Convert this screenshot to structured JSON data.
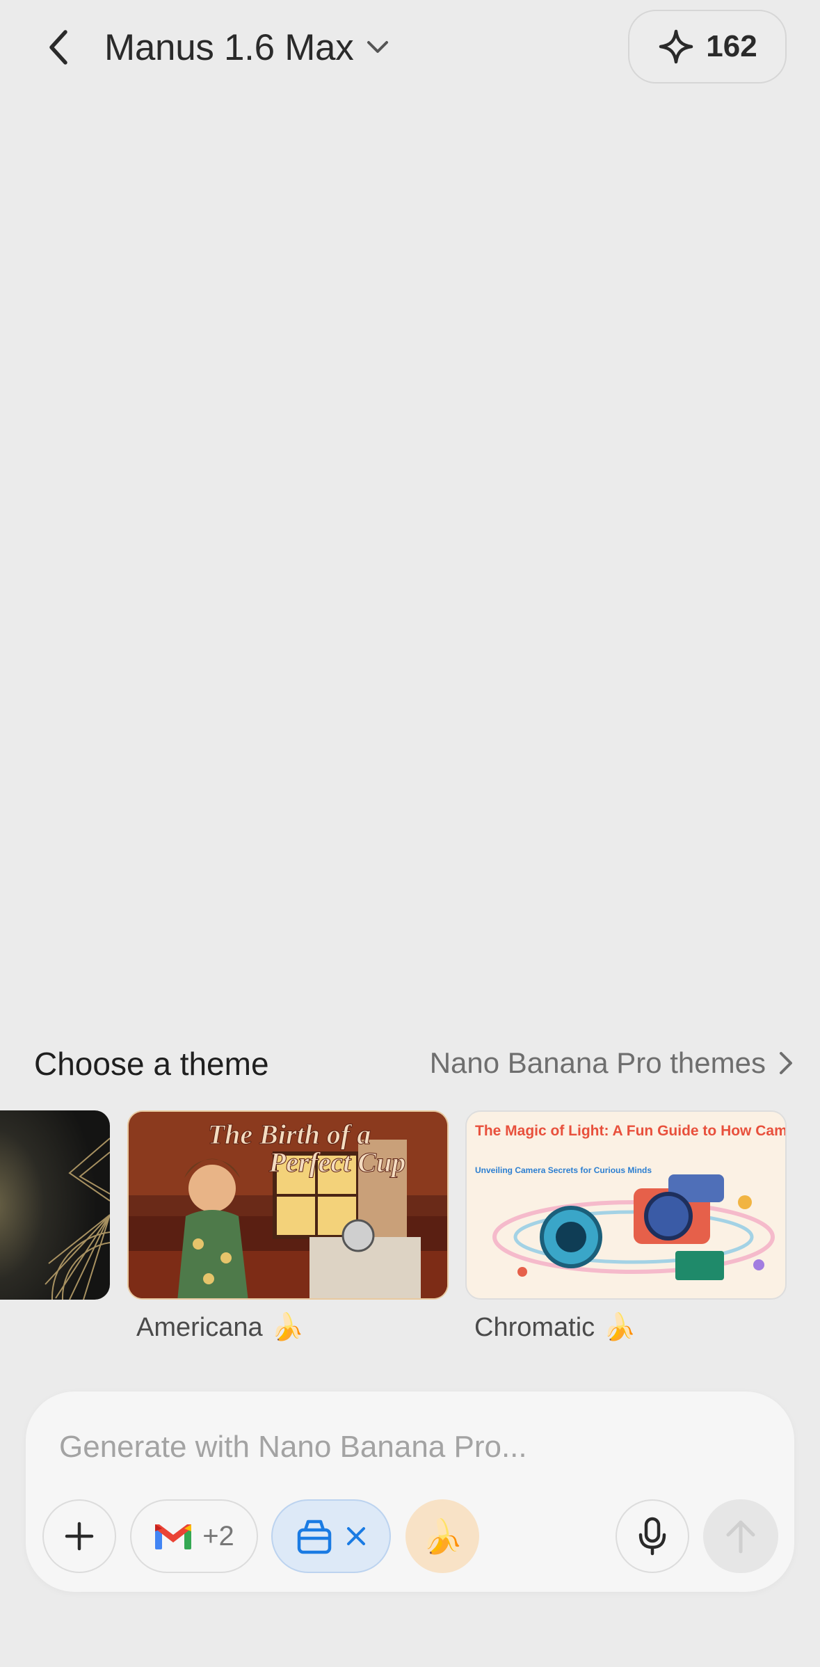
{
  "header": {
    "model_name": "Manus 1.6 Max",
    "credits": "162"
  },
  "themes": {
    "title": "Choose a theme",
    "link_label": "Nano Banana Pro themes",
    "cards": [
      {
        "label": "",
        "emoji": ""
      },
      {
        "label": "Americana",
        "emoji": "🍌",
        "image_title_line1": "The Birth of a",
        "image_title_line2": "Perfect Cup"
      },
      {
        "label": "Chromatic",
        "emoji": "🍌",
        "image_title": "The Magic of Light: A Fun Guide to How Cameras Work",
        "image_subtitle": "Unveiling Camera Secrets for Curious Minds"
      }
    ]
  },
  "composer": {
    "placeholder": "Generate with Nano Banana Pro...",
    "value": "",
    "connector_count": "+2",
    "banana_emoji": "🍌"
  },
  "colors": {
    "background": "#ebebeb",
    "composer_bg": "#f6f6f6",
    "tool_chip_bg": "#dde9f7",
    "tool_chip_accent": "#1a7be3",
    "banana_chip_bg": "#f8e2c6"
  },
  "icons": [
    "chevron-left-icon",
    "chevron-down-icon",
    "sparkle-icon",
    "chevron-right-icon",
    "plus-icon",
    "gmail-icon",
    "toolbox-icon",
    "close-icon",
    "banana-icon",
    "microphone-icon",
    "arrow-up-icon"
  ]
}
